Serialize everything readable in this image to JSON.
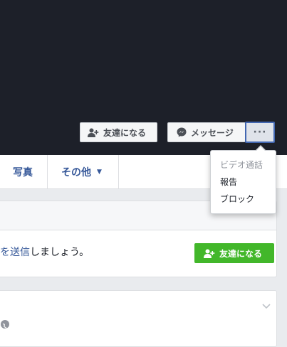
{
  "profile_actions": {
    "add_friend_label": "友達になる",
    "message_label": "メッセージ",
    "more_label": "···"
  },
  "nav": {
    "tabs": [
      {
        "label": "写真"
      },
      {
        "label": "その他"
      }
    ],
    "more_caret": "▼"
  },
  "more_menu": {
    "items": [
      {
        "label": "ビデオ通話",
        "enabled": false
      },
      {
        "label": "報告",
        "enabled": true
      },
      {
        "label": "ブロック",
        "enabled": true
      }
    ]
  },
  "friend_request_card": {
    "text_link": "を送信",
    "text_rest": "しましょう。",
    "button_label": "友達になる"
  },
  "colors": {
    "cover": "#1d2029",
    "link": "#365899",
    "green_button": "#42b72a",
    "focus_border": "#4267b2"
  },
  "icons": {
    "add_friend": "add-friend-icon",
    "messenger": "messenger-icon",
    "chevron": "chevron-down-icon",
    "globe": "globe-icon"
  }
}
